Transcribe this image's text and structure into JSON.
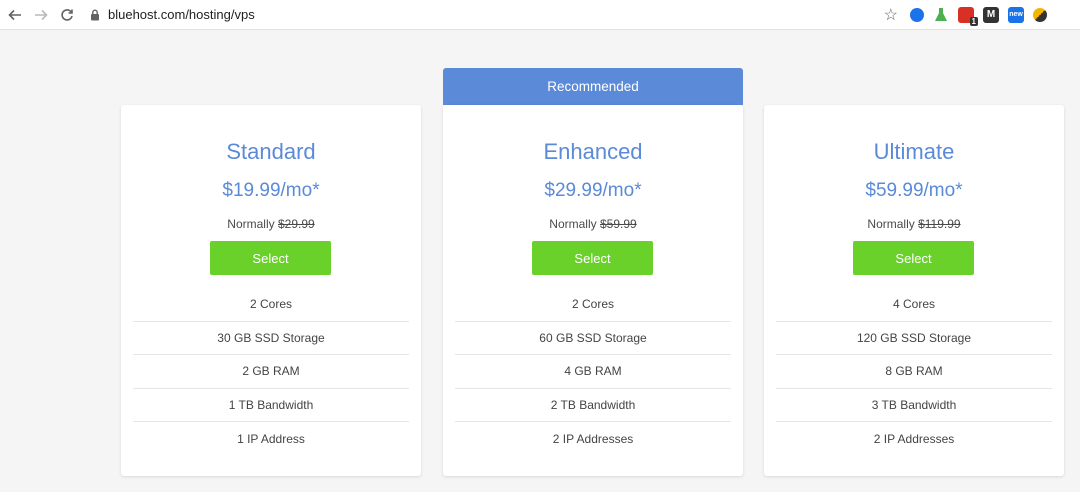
{
  "browser": {
    "url": "bluehost.com/hosting/vps",
    "extensions": [
      {
        "name": "extension-blue-icon",
        "color": "#1a73e8"
      },
      {
        "name": "extension-flask-icon",
        "color": "#4caf50"
      },
      {
        "name": "extension-red-badge-icon",
        "color": "#d93025",
        "badge": "1"
      },
      {
        "name": "extension-m-icon",
        "color": "#333333",
        "label": "M"
      },
      {
        "name": "extension-new-icon",
        "color": "#1a73e8",
        "label": "new"
      },
      {
        "name": "extension-multicolor-icon",
        "color": "#f4b400"
      }
    ]
  },
  "recommended_label": "Recommended",
  "plans": [
    {
      "name": "Standard",
      "price": "$19.99/mo*",
      "normally_label": "Normally",
      "normally_price": "$29.99",
      "select_label": "Select",
      "features": [
        "2 Cores",
        "30 GB SSD Storage",
        "2 GB RAM",
        "1 TB Bandwidth",
        "1 IP Address"
      ]
    },
    {
      "name": "Enhanced",
      "price": "$29.99/mo*",
      "normally_label": "Normally",
      "normally_price": "$59.99",
      "select_label": "Select",
      "features": [
        "2 Cores",
        "60 GB SSD Storage",
        "4 GB RAM",
        "2 TB Bandwidth",
        "2 IP Addresses"
      ]
    },
    {
      "name": "Ultimate",
      "price": "$59.99/mo*",
      "normally_label": "Normally",
      "normally_price": "$119.99",
      "select_label": "Select",
      "features": [
        "4 Cores",
        "120 GB SSD Storage",
        "8 GB RAM",
        "3 TB Bandwidth",
        "2 IP Addresses"
      ]
    }
  ],
  "colors": {
    "accent": "#5b8ad8",
    "select_button": "#6ad12b",
    "background": "#f5f5f5"
  }
}
